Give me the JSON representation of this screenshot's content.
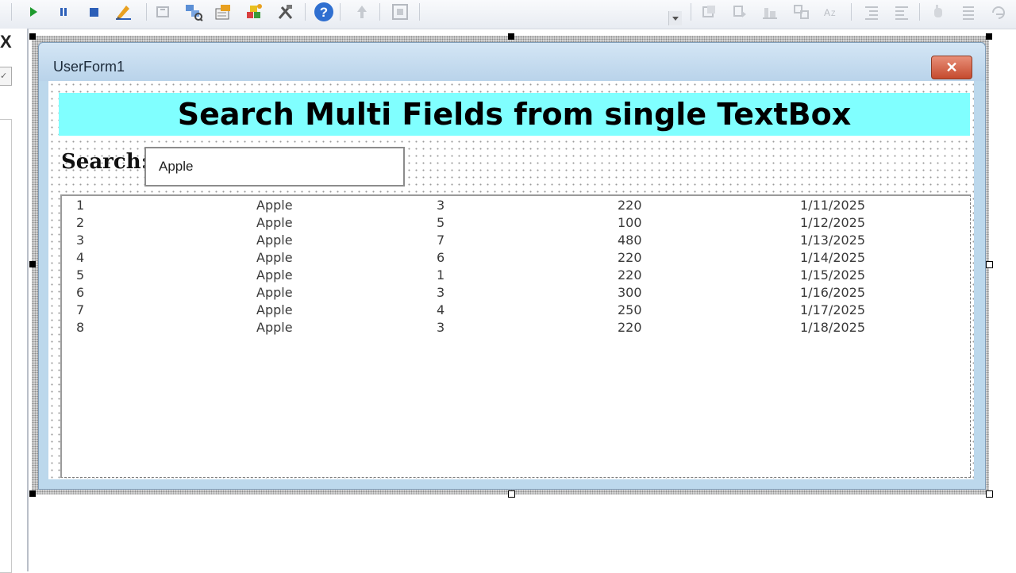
{
  "form": {
    "title": "UserForm1",
    "close_label": "✕"
  },
  "header": {
    "title": "Search Multi Fields from single TextBox",
    "background": "#80ffff"
  },
  "search": {
    "label": "Search:",
    "value": "Apple"
  },
  "listbox": {
    "rows": [
      [
        "1",
        "Apple",
        "3",
        "220",
        "1/11/2025"
      ],
      [
        "2",
        "Apple",
        "5",
        "100",
        "1/12/2025"
      ],
      [
        "3",
        "Apple",
        "7",
        "480",
        "1/13/2025"
      ],
      [
        "4",
        "Apple",
        "6",
        "220",
        "1/14/2025"
      ],
      [
        "5",
        "Apple",
        "1",
        "220",
        "1/15/2025"
      ],
      [
        "6",
        "Apple",
        "3",
        "300",
        "1/16/2025"
      ],
      [
        "7",
        "Apple",
        "4",
        "250",
        "1/17/2025"
      ],
      [
        "8",
        "Apple",
        "3",
        "220",
        "1/18/2025"
      ]
    ]
  },
  "left_panel": {
    "close_glyph": "X",
    "check_glyph": "✓"
  },
  "toolbar": {
    "icons": [
      "run-icon",
      "pause-icon",
      "stop-icon",
      "design-mode-icon",
      "project-explorer-icon",
      "properties-icon",
      "object-browser-icon",
      "toolbox-icon",
      "help-icon"
    ]
  }
}
